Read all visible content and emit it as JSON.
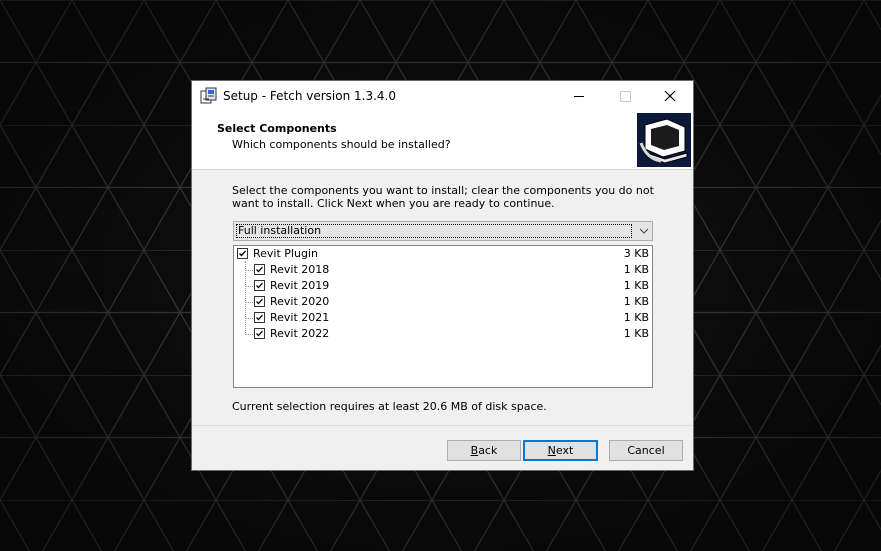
{
  "window": {
    "title": "Setup - Fetch version 1.3.4.0",
    "controls": [
      "minimize-icon",
      "maximize-icon",
      "close-icon"
    ]
  },
  "header": {
    "title": "Select Components",
    "subtitle": "Which components should be installed?"
  },
  "description": "Select the components you want to install; clear the components you do not want to install. Click Next when you are ready to continue.",
  "install_type": {
    "selected": "Full installation"
  },
  "components": [
    {
      "label": "Revit Plugin",
      "size": "3 KB",
      "checked": true,
      "level": 0
    },
    {
      "label": "Revit 2018",
      "size": "1 KB",
      "checked": true,
      "level": 1
    },
    {
      "label": "Revit 2019",
      "size": "1 KB",
      "checked": true,
      "level": 1
    },
    {
      "label": "Revit 2020",
      "size": "1 KB",
      "checked": true,
      "level": 1
    },
    {
      "label": "Revit 2021",
      "size": "1 KB",
      "checked": true,
      "level": 1
    },
    {
      "label": "Revit 2022",
      "size": "1 KB",
      "checked": true,
      "level": 1
    }
  ],
  "disk_requirement": "Current selection requires at least 20.6 MB of disk space.",
  "buttons": {
    "back": {
      "label": "Back",
      "accel": "B"
    },
    "next": {
      "label": "Next",
      "accel": "N"
    },
    "cancel": {
      "label": "Cancel"
    }
  },
  "colors": {
    "background": "#0d0d0d",
    "dialog": "#f0f0f0",
    "focus_border": "#0078d7"
  }
}
